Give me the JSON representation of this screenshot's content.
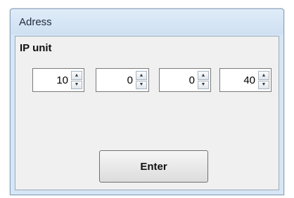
{
  "window": {
    "title": "Adress"
  },
  "ip_unit": {
    "label": "IP unit",
    "octets": [
      "10",
      "0",
      "0",
      "40"
    ]
  },
  "enter_button": {
    "label": "Enter"
  },
  "icons": {
    "spin_up": "triangle-up-icon",
    "spin_down": "triangle-down-icon"
  },
  "colors": {
    "title_bar": "#d7e6f5",
    "client_bg": "#f0f0f0"
  }
}
